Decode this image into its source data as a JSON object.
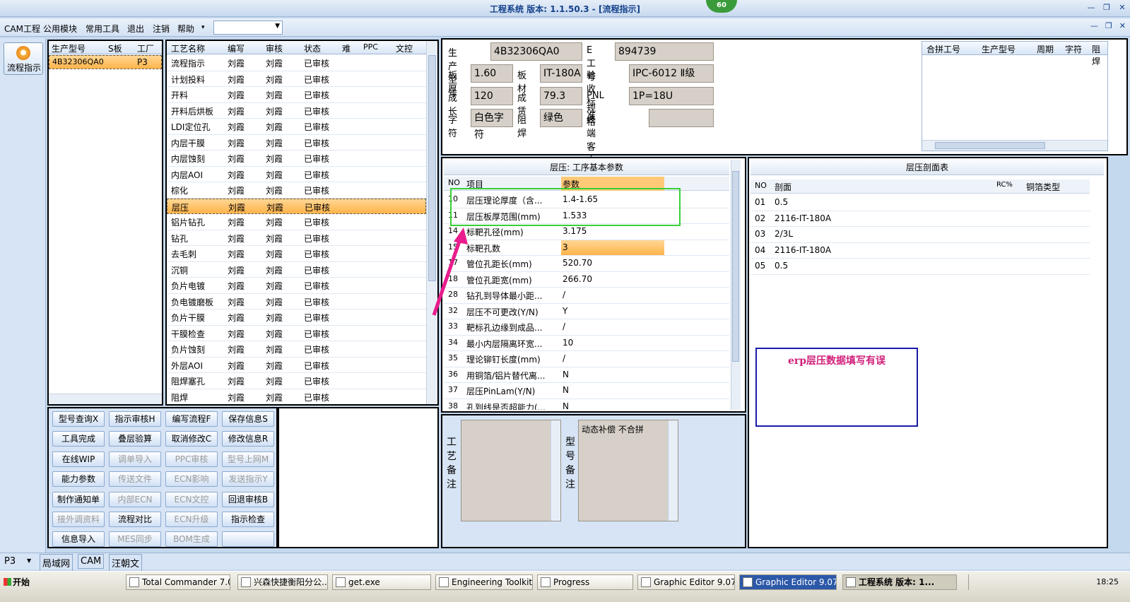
{
  "window": {
    "title": "工程系统  版本: 1.1.50.3 - [流程指示]",
    "badge": "60"
  },
  "menu": {
    "items": [
      "CAM工程",
      "公用模块",
      "常用工具",
      "退出",
      "注销",
      "帮助",
      "▾"
    ]
  },
  "rail": {
    "flow_label": "流程指示"
  },
  "models": {
    "headers": [
      "生产型号",
      "S板",
      "工厂"
    ],
    "rows": [
      [
        "4B32306QA0",
        "",
        "P3"
      ]
    ]
  },
  "process": {
    "headers": [
      "工艺名称",
      "编写",
      "审核",
      "状态",
      "难",
      "PPC",
      "文控"
    ],
    "rows": [
      [
        "流程指示",
        "刘霞",
        "刘霞",
        "已审核"
      ],
      [
        "计划投料",
        "刘霞",
        "刘霞",
        "已审核"
      ],
      [
        "开料",
        "刘霞",
        "刘霞",
        "已审核"
      ],
      [
        "开料后烘板",
        "刘霞",
        "刘霞",
        "已审核"
      ],
      [
        "LDI定位孔",
        "刘霞",
        "刘霞",
        "已审核"
      ],
      [
        "内层干膜",
        "刘霞",
        "刘霞",
        "已审核"
      ],
      [
        "内层蚀刻",
        "刘霞",
        "刘霞",
        "已审核"
      ],
      [
        "内层AOI",
        "刘霞",
        "刘霞",
        "已审核"
      ],
      [
        "棕化",
        "刘霞",
        "刘霞",
        "已审核"
      ],
      [
        "层压",
        "刘霞",
        "刘霞",
        "已审核"
      ],
      [
        "铝片钻孔",
        "刘霞",
        "刘霞",
        "已审核"
      ],
      [
        "钻孔",
        "刘霞",
        "刘霞",
        "已审核"
      ],
      [
        "去毛刺",
        "刘霞",
        "刘霞",
        "已审核"
      ],
      [
        "沉铜",
        "刘霞",
        "刘霞",
        "已审核"
      ],
      [
        "负片电镀",
        "刘霞",
        "刘霞",
        "已审核"
      ],
      [
        "负电镀磨板",
        "刘霞",
        "刘霞",
        "已审核"
      ],
      [
        "负片干膜",
        "刘霞",
        "刘霞",
        "已审核"
      ],
      [
        "干膜检查",
        "刘霞",
        "刘霞",
        "已审核"
      ],
      [
        "负片蚀刻",
        "刘霞",
        "刘霞",
        "已审核"
      ],
      [
        "外层AOI",
        "刘霞",
        "刘霞",
        "已审核"
      ],
      [
        "阻焊塞孔",
        "刘霞",
        "刘霞",
        "已审核"
      ],
      [
        "阻焊",
        "刘霞",
        "刘霞",
        "已审核"
      ]
    ],
    "selected": 9
  },
  "buttons": [
    [
      "型号查询X",
      "指示审核H",
      "编写流程F",
      "保存信息S"
    ],
    [
      "工具完成",
      "叠层验算",
      "取消修改C",
      "修改信息R"
    ],
    [
      "在线WIP",
      "调单导入",
      "PPC审核",
      "型号上网M"
    ],
    [
      "能力参数",
      "传送文件",
      "ECN影响",
      "发送指示Y"
    ],
    [
      "制作通知单",
      "内部ECN",
      "ECN文控",
      "回退审核B"
    ],
    [
      "接外调资料",
      "流程对比",
      "ECN升级",
      "指示检查"
    ],
    [
      "信息导入",
      "MES同步",
      "BOM生成",
      ""
    ]
  ],
  "buttons_disabled": [
    [
      false,
      false,
      false,
      false
    ],
    [
      false,
      false,
      false,
      false
    ],
    [
      false,
      true,
      true,
      true
    ],
    [
      false,
      true,
      true,
      true
    ],
    [
      false,
      true,
      true,
      false
    ],
    [
      true,
      false,
      true,
      false
    ],
    [
      false,
      true,
      true,
      false
    ]
  ],
  "info": {
    "prod_model_label": "生产型号",
    "prod_model": "4B32306QA0",
    "e_label": "E工号",
    "e_no": "894739",
    "thick_label": "板厚",
    "thick": "1.60",
    "mat_label": "板材",
    "mat": "IT-180A",
    "std_label": "验收标准",
    "std": "IPC-6012 Ⅱ级",
    "grow_label": "成长",
    "grow": "120",
    "rate_label": "成赁",
    "rate": "79.3",
    "pnl_label": "PNL规格",
    "pnl": "1P=18U",
    "char_label": "字符",
    "char": "白色字符",
    "mask_label": "阻焊",
    "mask": "绿色",
    "cust_label": "终端客户代码",
    "cust": ""
  },
  "merge": {
    "headers": [
      "合拼工号",
      "生产型号",
      "周期",
      "字符",
      "阻焊"
    ]
  },
  "params": {
    "title": "层压: 工序基本参数",
    "headers": [
      "NO",
      "项目",
      "参数"
    ],
    "rows": [
      [
        "10",
        "层压理论厚度（含...",
        "1.4-1.65"
      ],
      [
        "11",
        "层压板厚范围(mm)",
        "1.533"
      ],
      [
        "14",
        "标靶孔径(mm)",
        "3.175"
      ],
      [
        "15",
        "标靶孔数",
        "3"
      ],
      [
        "17",
        "管位孔距长(mm)",
        "520.70"
      ],
      [
        "18",
        "管位孔距宽(mm)",
        "266.70"
      ],
      [
        "28",
        "钻孔到导体最小距...",
        "/"
      ],
      [
        "32",
        "层压不可更改(Y/N)",
        "Y"
      ],
      [
        "33",
        "靶标孔边缘到成品...",
        "/"
      ],
      [
        "34",
        "最小内层隔离环宽...",
        "10"
      ],
      [
        "35",
        "理论铆钉长度(mm)",
        "/"
      ],
      [
        "36",
        "用铜箔/铝片替代离...",
        "N"
      ],
      [
        "37",
        "层压PinLam(Y/N)",
        "N"
      ],
      [
        "38",
        "孔到线是否超能力(...",
        "N"
      ]
    ],
    "highlight": 3
  },
  "stack": {
    "title": "层压剖面表",
    "headers": [
      "NO",
      "剖面",
      "RC%",
      "铜箔类型"
    ],
    "rows": [
      [
        "01",
        "0.5"
      ],
      [
        "02",
        "2116-IT-180A"
      ],
      [
        "03",
        "2/3L"
      ],
      [
        "04",
        "2116-IT-180A"
      ],
      [
        "05",
        "0.5"
      ]
    ]
  },
  "annotation": "erp层压数据填写有误",
  "remark": {
    "process_label": "工艺备注",
    "model_label": "型号备注",
    "model_text": "动态补偿  不合拼"
  },
  "status": {
    "site": "P3",
    "tabs": [
      "局域网",
      "CAM",
      "汪朝文"
    ]
  },
  "taskbar": {
    "start": "开始",
    "items": [
      "Total Commander 7.0 ...",
      "兴森快捷衡阳分公...",
      "get.exe",
      "Engineering Toolkit 9....",
      "Progress",
      "Graphic Editor 9.07b2...",
      "Graphic Editor 9.07b2...",
      "工程系统  版本: 1..."
    ],
    "clock": "18:25"
  },
  "colors": {
    "accent": "#ffb34a",
    "annotation_box": "#1a1aa8",
    "annotation_text": "#d0207a",
    "arrow": "#e81c8c",
    "green_box": "#39d039"
  }
}
